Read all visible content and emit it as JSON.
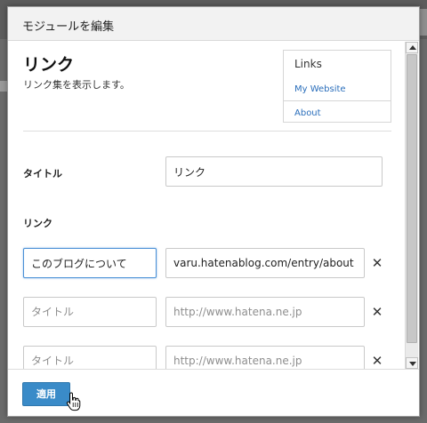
{
  "dialog": {
    "title": "モジュールを編集"
  },
  "module": {
    "name": "リンク",
    "description": "リンク集を表示します。"
  },
  "preview": {
    "title": "Links",
    "links": [
      "My Website",
      "About"
    ]
  },
  "fields": {
    "title_label": "タイトル",
    "title_value": "リンク",
    "links_label": "リンク"
  },
  "links": [
    {
      "title_value": "このブログについて",
      "title_placeholder": "タイトル",
      "url_value": "varu.hatenablog.com/entry/about",
      "url_placeholder": "http://www.hatena.ne.jp",
      "remove": "✕"
    },
    {
      "title_value": "",
      "title_placeholder": "タイトル",
      "url_value": "",
      "url_placeholder": "http://www.hatena.ne.jp",
      "remove": "✕"
    },
    {
      "title_value": "",
      "title_placeholder": "タイトル",
      "url_value": "",
      "url_placeholder": "http://www.hatena.ne.jp",
      "remove": "✕"
    }
  ],
  "footer": {
    "apply_label": "適用"
  },
  "icons": {
    "remove": "close-icon",
    "scroll_up": "arrow-up-icon",
    "scroll_down": "arrow-down-icon",
    "cursor": "hand-cursor-icon"
  },
  "colors": {
    "accent": "#3a8bc8",
    "link": "#2a6ebb",
    "focus": "#4a90d6"
  }
}
